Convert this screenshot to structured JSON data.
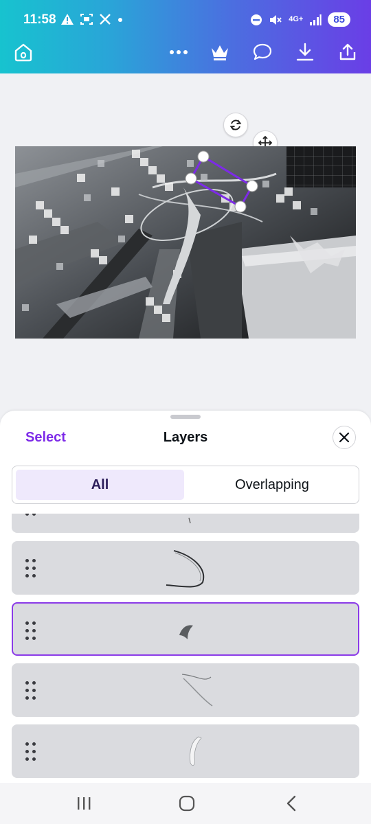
{
  "status_bar": {
    "time": "11:58",
    "network": "4G+",
    "battery": "85",
    "icons": [
      "alert-icon",
      "screenshot-icon",
      "x-logo-icon",
      "dot-icon",
      "dnd-icon",
      "mute-icon",
      "signal-icon"
    ]
  },
  "toolbar": {
    "icons": [
      "home-icon",
      "more-icon",
      "crown-icon",
      "comment-icon",
      "download-icon",
      "share-icon"
    ]
  },
  "canvas": {
    "controls": [
      "rotate-icon",
      "move-icon"
    ]
  },
  "layers_panel": {
    "select_label": "Select",
    "title": "Layers",
    "tabs": [
      {
        "label": "All",
        "active": true
      },
      {
        "label": "Overlapping",
        "active": false
      }
    ],
    "items": [
      {
        "thumbnail": "partial-layer",
        "selected": false
      },
      {
        "thumbnail": "curved-line",
        "selected": false
      },
      {
        "thumbnail": "small-shard",
        "selected": true
      },
      {
        "thumbnail": "thin-arc",
        "selected": false
      },
      {
        "thumbnail": "white-wisp",
        "selected": false
      }
    ]
  },
  "nav_bar": {
    "icons": [
      "recents-icon",
      "home-icon",
      "back-icon"
    ]
  },
  "colors": {
    "accent": "#7d2ae8",
    "selection": "#8b3ae8",
    "gradient_start": "#17c3cf",
    "gradient_end": "#6a3ee6"
  }
}
